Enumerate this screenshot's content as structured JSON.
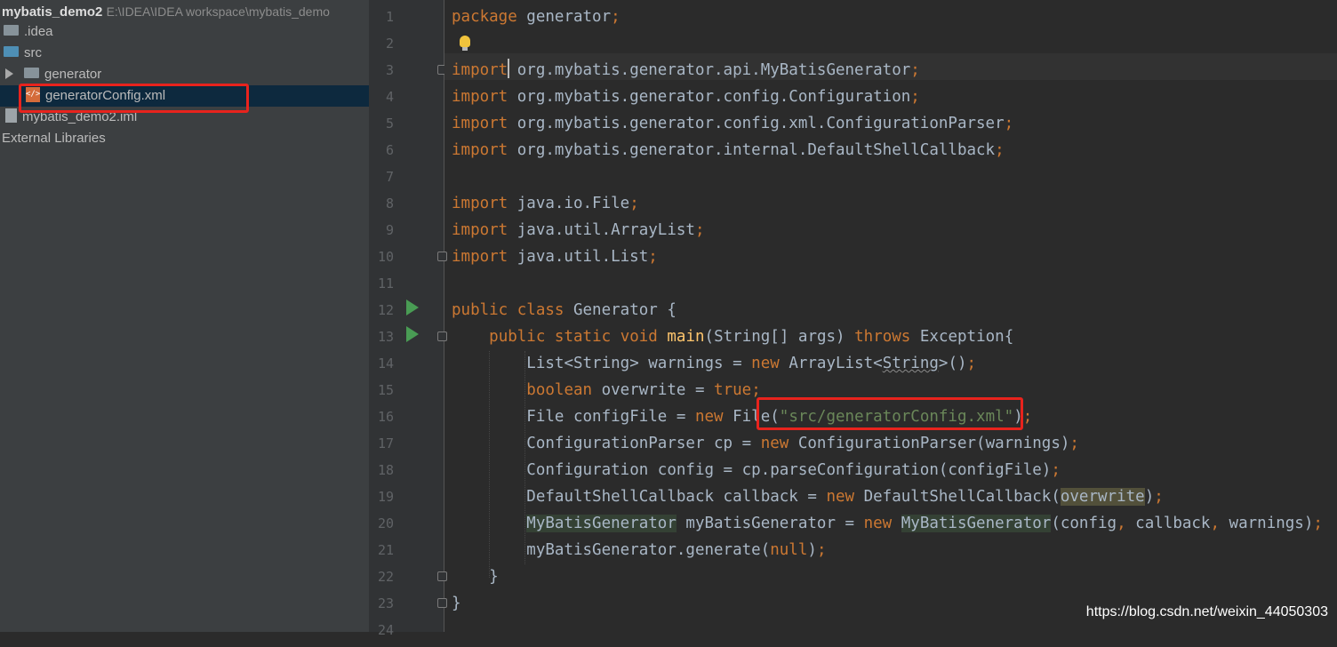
{
  "project_panel": {
    "title": "mybatis_demo2",
    "title_path": "E:\\IDEA\\IDEA workspace\\mybatis_demo",
    "items": [
      {
        "label": ".idea"
      },
      {
        "label": "src"
      },
      {
        "label": "generator"
      },
      {
        "label": "generatorConfig.xml"
      },
      {
        "label": "mybatis_demo2.iml"
      },
      {
        "label": "External Libraries"
      }
    ]
  },
  "editor": {
    "line_numbers": [
      "1",
      "2",
      "3",
      "4",
      "5",
      "6",
      "7",
      "8",
      "9",
      "10",
      "11",
      "12",
      "13",
      "14",
      "15",
      "16",
      "17",
      "18",
      "19",
      "20",
      "21",
      "22",
      "23",
      "24"
    ],
    "tokens": {
      "package": "package",
      "import": "import",
      "public": "public",
      "class": "class",
      "static": "static",
      "void": "void",
      "throws": "throws",
      "new": "new",
      "boolean": "boolean",
      "true": "true",
      "null": "null",
      "semicolon": ";",
      "pkg_name": " generator",
      "imp1": "org.mybatis.generator.api.MyBatisGenerator",
      "imp2": " org.mybatis.generator.config.Configuration",
      "imp3": " org.mybatis.generator.config.xml.ConfigurationParser",
      "imp4": " org.mybatis.generator.internal.DefaultShellCallback",
      "imp5": " java.io.File",
      "imp6": " java.util.ArrayList",
      "imp7": " java.util.List",
      "class_name": " Generator {",
      "method_name": "main",
      "method_params": "(String[] args) ",
      "exception": " Exception{",
      "l14a": "List<String> warnings = ",
      "l14b": " ArrayList<",
      "l14c": "String",
      "l14d": ">()",
      "l15": " overwrite = ",
      "l16a": "File configFile = ",
      "l16b": " File(",
      "l16str": "\"src/generatorConfig.xml\"",
      "l16c": ")",
      "l17a": "ConfigurationParser cp = ",
      "l17b": " ConfigurationParser(warnings)",
      "l18": "Configuration config = cp.parseConfiguration(configFile)",
      "l19a": "DefaultShellCallback callback = ",
      "l19b": " DefaultShellCallback(",
      "l19c": "overwrite",
      "l19d": ")",
      "l20a": "MyBatisGenerator",
      "l20b": " myBatisGenerator = ",
      "l20c": "MyBatisGenerator",
      "l20d": "(config",
      "l20e": " callback",
      "l20f": " warnings)",
      "comma": ",",
      "l21a": "myBatisGenerator.generate(",
      "l21b": ")",
      "brace": "}"
    }
  },
  "watermark": "https://blog.csdn.net/weixin_44050303",
  "colors": {
    "keyword": "#cc7832",
    "string": "#6a8759",
    "function": "#ffc66d",
    "text": "#a9b7c6",
    "highlight_box": "#e8231d"
  }
}
